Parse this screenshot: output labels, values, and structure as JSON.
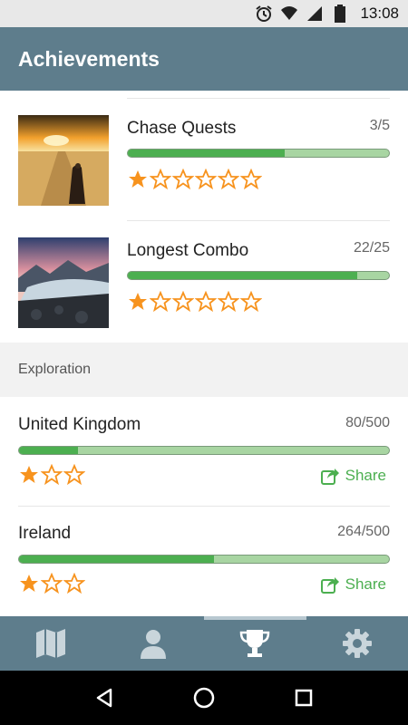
{
  "status_bar": {
    "time": "13:08",
    "icons": [
      "alarm-icon",
      "wifi-icon",
      "signal-icon",
      "battery-icon"
    ]
  },
  "app_bar": {
    "title": "Achievements"
  },
  "achievements": [
    {
      "name": "Chase Quests",
      "count": "3/5",
      "progress": 0.6,
      "stars_filled": 1,
      "stars_total": 6,
      "image": "desert-road-monk"
    },
    {
      "name": "Longest Combo",
      "count": "22/25",
      "progress": 0.88,
      "stars_filled": 1,
      "stars_total": 6,
      "image": "glacier-landscape"
    }
  ],
  "exploration": {
    "header": "Exploration",
    "items": [
      {
        "name": "United Kingdom",
        "count": "80/500",
        "progress": 0.16,
        "stars_filled": 1,
        "stars_total": 3,
        "share_label": "Share"
      },
      {
        "name": "Ireland",
        "count": "264/500",
        "progress": 0.528,
        "stars_filled": 1,
        "stars_total": 3,
        "share_label": "Share"
      }
    ]
  },
  "bottom_nav": {
    "items": [
      {
        "name": "map",
        "icon": "map-icon",
        "active": false
      },
      {
        "name": "profile",
        "icon": "person-icon",
        "active": false
      },
      {
        "name": "achievements",
        "icon": "trophy-icon",
        "active": true
      },
      {
        "name": "settings",
        "icon": "gear-icon",
        "active": false
      }
    ]
  },
  "colors": {
    "primary": "#5e7d8c",
    "accent_green": "#4caf50",
    "bar_track": "#a8d5a2",
    "star": "#f7931e"
  }
}
